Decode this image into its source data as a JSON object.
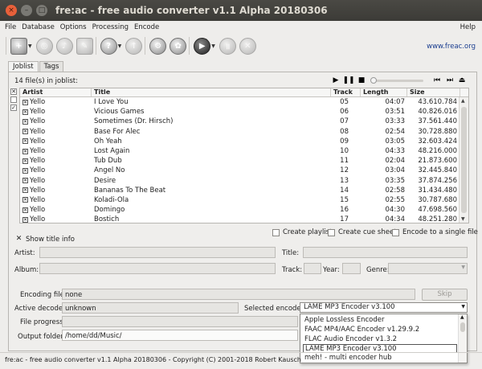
{
  "window": {
    "title": "fre:ac - free audio converter v1.1 Alpha 20180306"
  },
  "menu": {
    "items": [
      "File",
      "Database",
      "Options",
      "Processing",
      "Encode"
    ],
    "help": "Help"
  },
  "toolbar": {
    "url": "www.freac.org"
  },
  "tabs": [
    "Joblist",
    "Tags"
  ],
  "joblist": {
    "file_count": "14 file(s) in joblist:",
    "columns": [
      "Artist",
      "Title",
      "Track",
      "Length",
      "Size"
    ],
    "rows": [
      [
        "Yello",
        "I Love You",
        "05",
        "04:07",
        "43.610.784"
      ],
      [
        "Yello",
        "Vicious Games",
        "06",
        "03:51",
        "40.826.016"
      ],
      [
        "Yello",
        "Sometimes (Dr. Hirsch)",
        "07",
        "03:33",
        "37.561.440"
      ],
      [
        "Yello",
        "Base For Alec",
        "08",
        "02:54",
        "30.728.880"
      ],
      [
        "Yello",
        "Oh Yeah",
        "09",
        "03:05",
        "32.603.424"
      ],
      [
        "Yello",
        "Lost Again",
        "10",
        "04:33",
        "48.216.000"
      ],
      [
        "Yello",
        "Tub Dub",
        "11",
        "02:04",
        "21.873.600"
      ],
      [
        "Yello",
        "Angel No",
        "12",
        "03:04",
        "32.445.840"
      ],
      [
        "Yello",
        "Desire",
        "13",
        "03:35",
        "37.874.256"
      ],
      [
        "Yello",
        "Bananas To The Beat",
        "14",
        "02:58",
        "31.434.480"
      ],
      [
        "Yello",
        "Koladi-Ola",
        "15",
        "02:55",
        "30.787.680"
      ],
      [
        "Yello",
        "Domingo",
        "16",
        "04:30",
        "47.698.560"
      ],
      [
        "Yello",
        "Bostich",
        "17",
        "04:34",
        "48.251.280"
      ]
    ]
  },
  "options": {
    "create_playlist": "Create playlist",
    "create_cue": "Create cue sheet",
    "single_file": "Encode to a single file"
  },
  "title_info": {
    "toggle": "Show title info",
    "artist": "Artist:",
    "title": "Title:",
    "album": "Album:",
    "track": "Track:",
    "year": "Year:",
    "genre": "Genre:"
  },
  "encoding": {
    "file_label": "Encoding file:",
    "file_value": "none",
    "decoder_label": "Active decoder:",
    "decoder_value": "unknown",
    "encoder_label": "Selected encoder:",
    "encoder_value": "LAME MP3 Encoder v3.100",
    "progress_label": "File progress:",
    "output_label": "Output folder:",
    "output_value": "/home/dd/Music/",
    "skip": "Skip"
  },
  "encoder_options": [
    "Apple Lossless Encoder",
    "FAAC MP4/AAC Encoder v1.29.9.2",
    "FLAC Audio Encoder v1.3.2",
    "LAME MP3 Encoder v3.100",
    "meh! - multi encoder hub"
  ],
  "status": "fre:ac - free audio converter v1.1 Alpha 20180306 - Copyright (C) 2001-2018 Robert Kausch"
}
